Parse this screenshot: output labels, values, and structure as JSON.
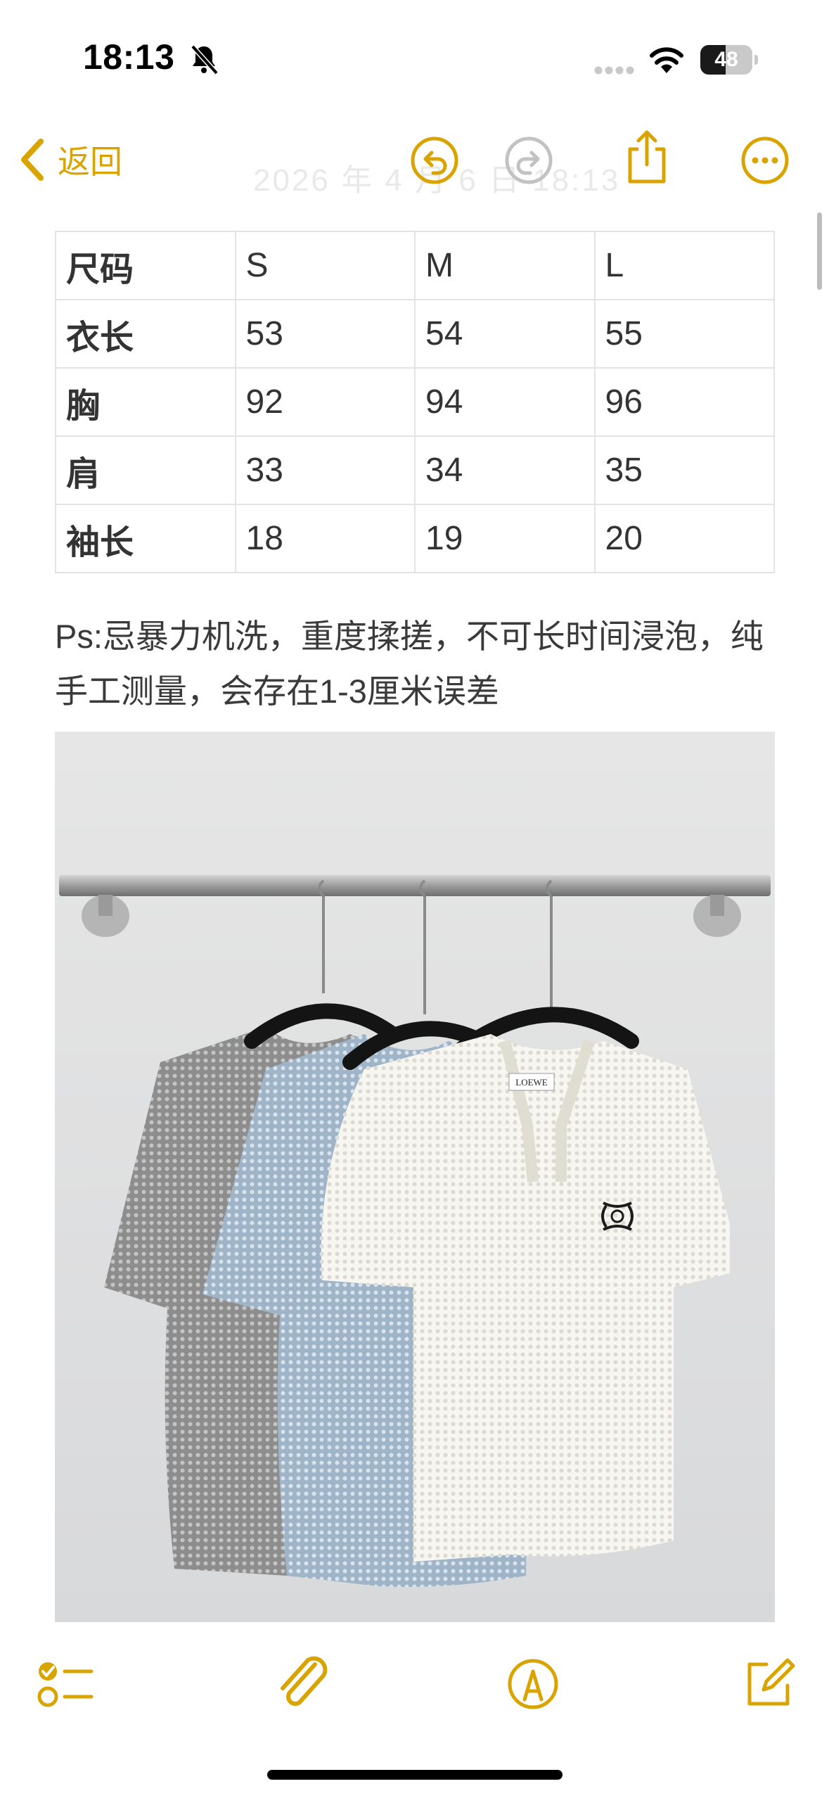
{
  "status_bar": {
    "time": "18:13",
    "battery_level": "48",
    "battery_fraction": 0.48,
    "icons": [
      "bell-slash-icon",
      "cellular-signal-icon",
      "wifi-icon",
      "battery-icon"
    ]
  },
  "nav": {
    "back_label": "返回",
    "faded_title": "2026 年 4 月 6 日 18:13",
    "accent_color": "#d9a400",
    "icons": [
      "chevron-left-icon",
      "undo-icon",
      "redo-icon",
      "share-icon",
      "more-icon"
    ]
  },
  "size_table": {
    "rows": [
      [
        "尺码",
        "S",
        "M",
        "L"
      ],
      [
        "衣长",
        "53",
        "54",
        "55"
      ],
      [
        "胸",
        "92",
        "94",
        "96"
      ],
      [
        "肩",
        "33",
        "34",
        "35"
      ],
      [
        "袖长",
        "18",
        "19",
        "20"
      ]
    ]
  },
  "note": {
    "text": "Ps:忌暴力机洗，重度揉搓，不可长时间浸泡，纯手工测量，会存在1-3厘米误差"
  },
  "photo": {
    "label_text": "LOEWE"
  },
  "toolbar": {
    "icons": [
      "checklist-icon",
      "paperclip-icon",
      "markup-pen-icon",
      "compose-icon"
    ]
  }
}
